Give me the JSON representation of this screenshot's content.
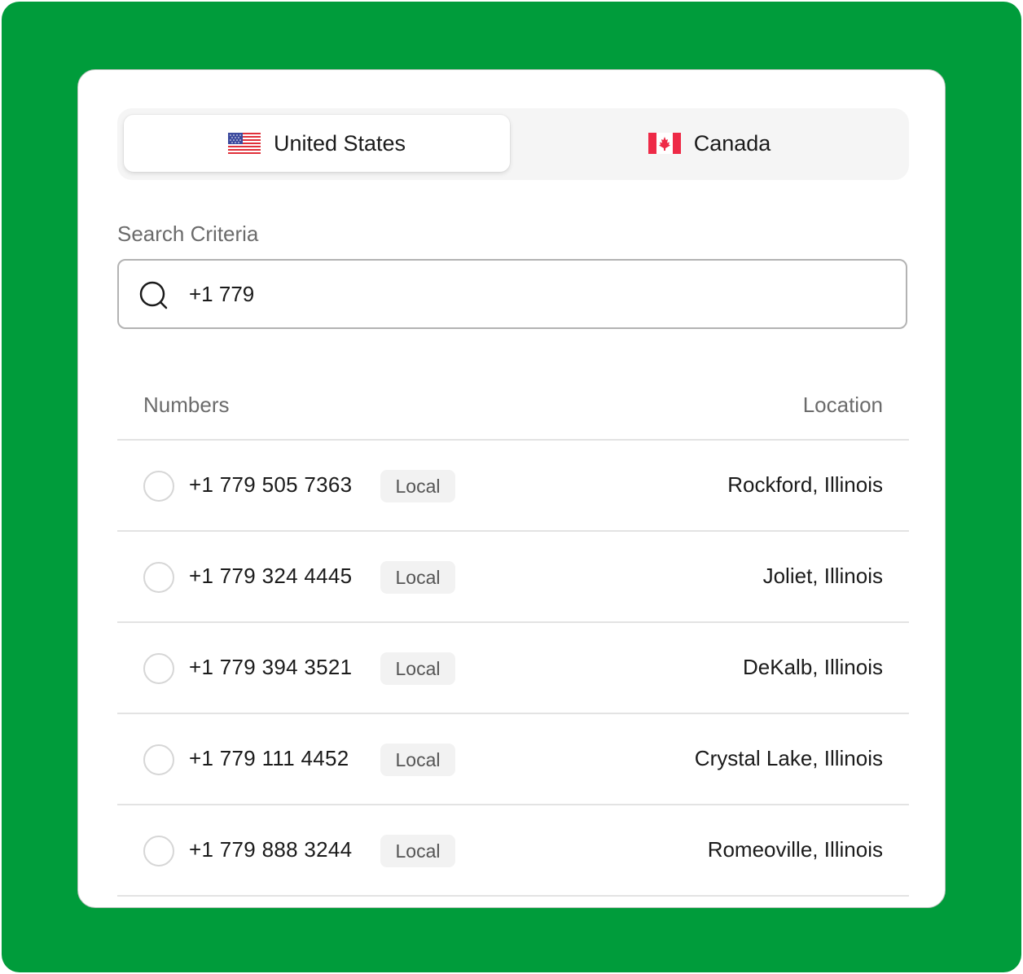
{
  "country_tabs": [
    {
      "label": "United States",
      "flag": "us-flag-icon",
      "selected": true
    },
    {
      "label": "Canada",
      "flag": "canada-flag-icon",
      "selected": false
    }
  ],
  "search": {
    "label": "Search Criteria",
    "value": "+1 779",
    "icon": "search-icon"
  },
  "table": {
    "headers": {
      "numbers": "Numbers",
      "location": "Location"
    },
    "rows": [
      {
        "number": "+1 779 505 7363",
        "type": "Local",
        "location": "Rockford, Illinois",
        "selected": false
      },
      {
        "number": "+1 779 324 4445",
        "type": "Local",
        "location": "Joliet, Illinois",
        "selected": false
      },
      {
        "number": "+1 779 394 3521",
        "type": "Local",
        "location": "DeKalb, Illinois",
        "selected": false
      },
      {
        "number": "+1 779 111 4452",
        "type": "Local",
        "location": "Crystal Lake, Illinois",
        "selected": false
      },
      {
        "number": "+1 779 888 3244",
        "type": "Local",
        "location": "Romeoville, Illinois",
        "selected": false
      }
    ]
  },
  "colors": {
    "background": "#009c3b",
    "card": "#ffffff",
    "segment_track": "#f5f5f5",
    "badge_bg": "#f2f2f2"
  }
}
